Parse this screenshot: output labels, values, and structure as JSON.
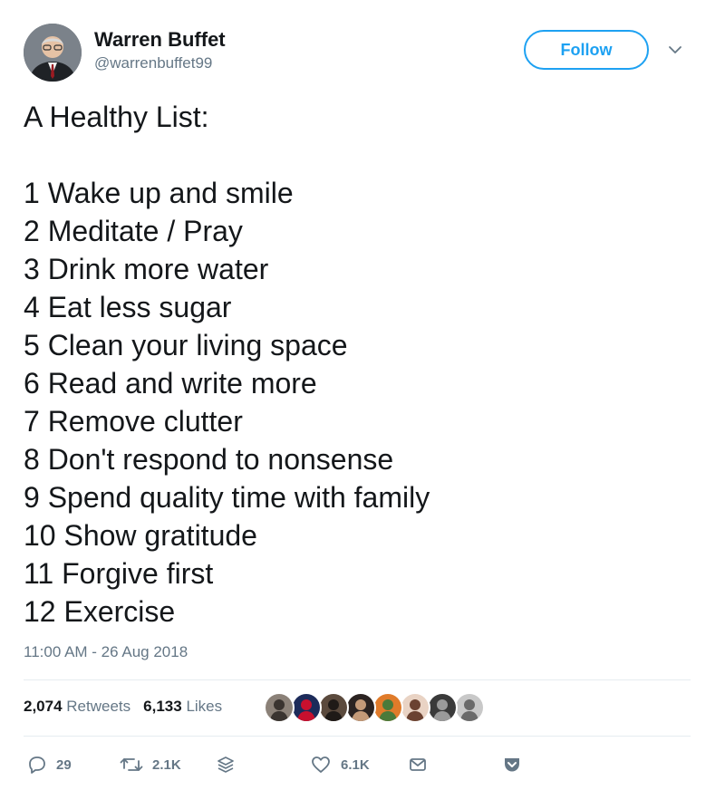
{
  "author": {
    "name": "Warren Buffet",
    "handle": "@warrenbuffet99",
    "avatar_icon": "person-in-suit"
  },
  "follow_label": "Follow",
  "tweet": {
    "intro": "A Healthy List:",
    "items": [
      "1 Wake up and smile",
      "2 Meditate / Pray",
      "3 Drink more water",
      "4 Eat less sugar",
      "5 Clean your living space",
      "6 Read and write more",
      "7 Remove clutter",
      "8 Don't respond to nonsense",
      "9 Spend quality time with family",
      "10 Show gratitude",
      "11 Forgive first",
      "12 Exercise"
    ],
    "timestamp": "11:00 AM - 26 Aug 2018"
  },
  "stats": {
    "retweets_count": "2,074",
    "retweets_label": "Retweets",
    "likes_count": "6,133",
    "likes_label": "Likes"
  },
  "likers": [
    {
      "icon": "bearded-man-photo",
      "bg": "#8b8178",
      "fg": "#3a3430"
    },
    {
      "icon": "team-logo",
      "bg": "#1c2b5a",
      "fg": "#c8102e"
    },
    {
      "icon": "man-in-suit-photo",
      "bg": "#5b4a3d",
      "fg": "#1f1a17"
    },
    {
      "icon": "woman-photo",
      "bg": "#2b2321",
      "fg": "#c49a78"
    },
    {
      "icon": "group-photo",
      "bg": "#e07b2a",
      "fg": "#4a7a3a"
    },
    {
      "icon": "woman-photo",
      "bg": "#e9d3c4",
      "fg": "#6b4231"
    },
    {
      "icon": "dark-portrait",
      "bg": "#3a3a3a",
      "fg": "#9a9a9a"
    },
    {
      "icon": "gray-portrait",
      "bg": "#c8c8c8",
      "fg": "#6a6a6a"
    }
  ],
  "actions": {
    "reply_count": "29",
    "retweet_count": "2.1K",
    "like_count": "6.1K"
  },
  "colors": {
    "accent": "#1da1f2",
    "secondary_text": "#657786",
    "primary_text": "#14171a",
    "divider": "#e6ecf0"
  }
}
